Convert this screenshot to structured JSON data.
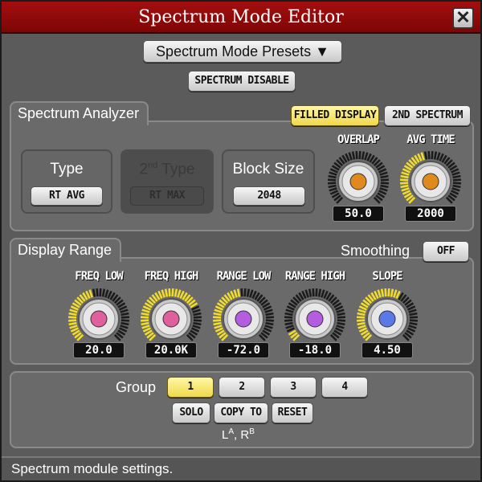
{
  "window": {
    "title": "Spectrum Mode Editor"
  },
  "toolbar": {
    "presets_label": "Spectrum Mode Presets ▼",
    "disable_label": "SPECTRUM DISABLE"
  },
  "analyzer": {
    "title": "Spectrum Analyzer",
    "filled_display_label": "FILLED DISPLAY",
    "second_spectrum_label": "2ND SPECTRUM",
    "type": {
      "label": "Type",
      "value": "RT AVG"
    },
    "second_type": {
      "label_main": "2",
      "label_sup": "nd",
      "label_rest": " Type",
      "value": "RT MAX"
    },
    "block_size": {
      "label": "Block Size",
      "value": "2048"
    },
    "knobs": [
      {
        "label": "OVERLAP",
        "value": "50.0",
        "level": 0.0,
        "color": "#e08a1e"
      },
      {
        "label": "AVG TIME",
        "value": "2000",
        "level": 0.45,
        "color": "#e08a1e"
      }
    ]
  },
  "display_range": {
    "title": "Display Range",
    "smoothing_label": "Smoothing",
    "smoothing_value": "OFF",
    "knobs": [
      {
        "label": "FREQ LOW",
        "value": "20.0",
        "level": 0.45,
        "color": "#e0609e"
      },
      {
        "label": "FREQ HIGH",
        "value": "20.0K",
        "level": 0.72,
        "color": "#e0609e"
      },
      {
        "label": "RANGE LOW",
        "value": "-72.0",
        "level": 0.48,
        "color": "#b55de0"
      },
      {
        "label": "RANGE HIGH",
        "value": "-18.0",
        "level": 0.08,
        "color": "#b55de0"
      },
      {
        "label": "SLOPE",
        "value": "4.50",
        "level": 0.6,
        "color": "#5a78e8"
      }
    ]
  },
  "group": {
    "label": "Group",
    "buttons": [
      "1",
      "2",
      "3",
      "4"
    ],
    "solo_label": "SOLO",
    "copy_label": "COPY TO",
    "reset_label": "RESET",
    "lr_l": "L",
    "lr_l_sup": "A",
    "lr_sep": ", R",
    "lr_r_sup": "B"
  },
  "status": {
    "text": "Spectrum module settings."
  },
  "colors": {
    "accent_on": "#f0d84a",
    "tick_active": "#f2dc2a",
    "tick_idle": "#1c1c1c",
    "title_bar": "#a40e0e"
  }
}
